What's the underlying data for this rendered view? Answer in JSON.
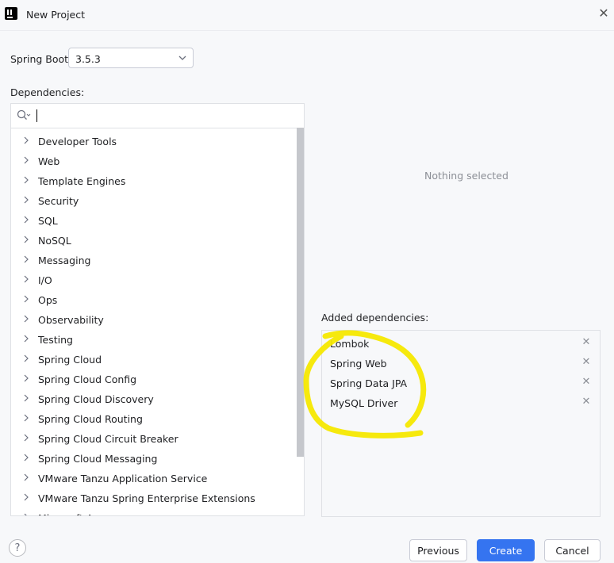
{
  "window": {
    "title": "New Project",
    "app_icon": "intellij-logo-icon",
    "close_icon": "close-icon"
  },
  "spring_boot": {
    "label": "Spring Boot:",
    "value": "3.5.3"
  },
  "dependencies": {
    "label": "Dependencies:",
    "search": {
      "value": "",
      "placeholder": ""
    },
    "categories": [
      "Developer Tools",
      "Web",
      "Template Engines",
      "Security",
      "SQL",
      "NoSQL",
      "Messaging",
      "I/O",
      "Ops",
      "Observability",
      "Testing",
      "Spring Cloud",
      "Spring Cloud Config",
      "Spring Cloud Discovery",
      "Spring Cloud Routing",
      "Spring Cloud Circuit Breaker",
      "Spring Cloud Messaging",
      "VMware Tanzu Application Service",
      "VMware Tanzu Spring Enterprise Extensions",
      "Microsoft Azure"
    ]
  },
  "details": {
    "empty_text": "Nothing selected"
  },
  "added": {
    "label": "Added dependencies:",
    "items": [
      "Lombok",
      "Spring Web",
      "Spring Data JPA",
      "MySQL Driver"
    ],
    "remove_icon": "close-icon"
  },
  "footer": {
    "help": "?",
    "previous": "Previous",
    "create": "Create",
    "cancel": "Cancel"
  },
  "colors": {
    "accent": "#3574f0",
    "annotation": "#f5e800",
    "muted": "#8c8f96"
  }
}
